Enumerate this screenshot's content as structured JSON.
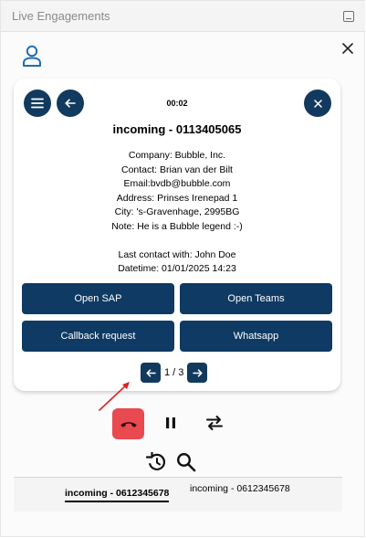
{
  "header": {
    "title": "Live Engagements"
  },
  "call": {
    "timer": "00:02",
    "title": "incoming - 0113405065",
    "details": [
      "Company: Bubble, Inc.",
      "Contact: Brian van der Bilt",
      "Email:bvdb@bubble.com",
      "Address: Prinses Irenepad 1",
      "City: 's-Gravenhage, 2995BG",
      "Note: He is a Bubble legend :-)",
      "",
      "Last contact with: John Doe",
      "Datetime: 01/01/2025 14:23"
    ]
  },
  "actions": {
    "open_sap": "Open SAP",
    "open_teams": "Open Teams",
    "callback": "Callback request",
    "whatsapp": "Whatsapp"
  },
  "pager": {
    "text": "1 / 3"
  },
  "tabs": [
    "incoming - 0612345678",
    "incoming - 0612345678"
  ],
  "colors": {
    "primary": "#0e3a63",
    "hangup": "#e84a4f",
    "accent_icon": "#1f6fb2",
    "annotation_arrow": "#e02020"
  }
}
